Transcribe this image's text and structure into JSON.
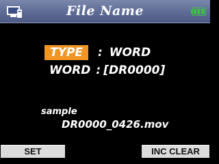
{
  "header": {
    "title": "File Name",
    "left_icon": "pc-monitor-icon",
    "right_icon": "battery-icon",
    "battery_color": "#3fbf3f"
  },
  "settings": {
    "type_label": "TYPE",
    "type_separator": ":",
    "type_value": "WORD",
    "word_label": "WORD",
    "word_separator": ":",
    "word_value": "[DR0000]"
  },
  "sample": {
    "label": "sample",
    "value": "DR0000_0426.mov"
  },
  "softkeys": {
    "left": "SET",
    "right": "INC CLEAR"
  },
  "colors": {
    "title_bar": "#5d6b95",
    "highlight": "#f19624",
    "background": "#000000",
    "softkey": "#dcdcdc"
  }
}
